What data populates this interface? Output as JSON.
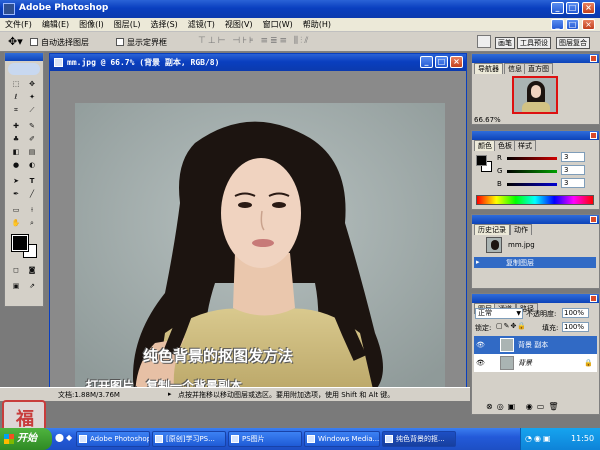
{
  "app": {
    "title": "Adobe Photoshop"
  },
  "menu": [
    "文件(F)",
    "编辑(E)",
    "图像(I)",
    "图层(L)",
    "选择(S)",
    "滤镜(T)",
    "视图(V)",
    "窗口(W)",
    "帮助(H)"
  ],
  "options": {
    "auto_select_layer": "自动选择图层",
    "show_bounding_box": "显示定界框",
    "palette_tabs": [
      "画笔",
      "工具预设",
      "图层复合"
    ]
  },
  "document": {
    "title": "mm.jpg @ 66.7% (背景 副本, RGB/8)",
    "caption_title": "纯色背景的抠图发方法",
    "caption_step": "一、打开图片，复制一个背景副本"
  },
  "status": {
    "zoom": "66.67%",
    "doc_size": "文档:1.88M/3.76M",
    "hint": "点按并拖移以移动图层或选区。要用附加选项，使用 Shift 和 Alt 键。"
  },
  "navigator": {
    "tabs": [
      "导航器",
      "信息",
      "直方图"
    ],
    "zoom": "66.67%"
  },
  "color_panel": {
    "tabs": [
      "颜色",
      "色板",
      "样式"
    ],
    "channels": [
      {
        "label": "R",
        "value": "3",
        "color": "#d00000"
      },
      {
        "label": "G",
        "value": "3",
        "color": "#00a000"
      },
      {
        "label": "B",
        "value": "3",
        "color": "#0000d0"
      }
    ]
  },
  "history": {
    "tabs": [
      "历史记录",
      "动作"
    ],
    "snapshot": "mm.jpg",
    "items": [
      "复制图层"
    ]
  },
  "layers": {
    "tabs": [
      "图层",
      "通道",
      "路径"
    ],
    "blend_mode": "正常",
    "opacity_label": "不透明度:",
    "opacity": "100%",
    "lock_label": "锁定:",
    "fill_label": "填充:",
    "fill": "100%",
    "rows": [
      {
        "name": "背景 副本",
        "selected": true
      },
      {
        "name": "背景",
        "selected": false
      }
    ]
  },
  "taskbar": {
    "start": "开始",
    "items": [
      "Adobe Photoshop",
      "[原创]学习PS...",
      "PS图片",
      "Windows Media...",
      "纯色背景的抠..."
    ],
    "clock": "11:50"
  },
  "watermark": {
    "seal_text": "福"
  },
  "colors": {
    "xp_blue": "#0a3fbf",
    "canvas_bg": "#8a8a8a",
    "photo_bg": "#a9b3b2",
    "selected_layer": "#316ac5",
    "taskbar_start": "#3a9a2f"
  }
}
